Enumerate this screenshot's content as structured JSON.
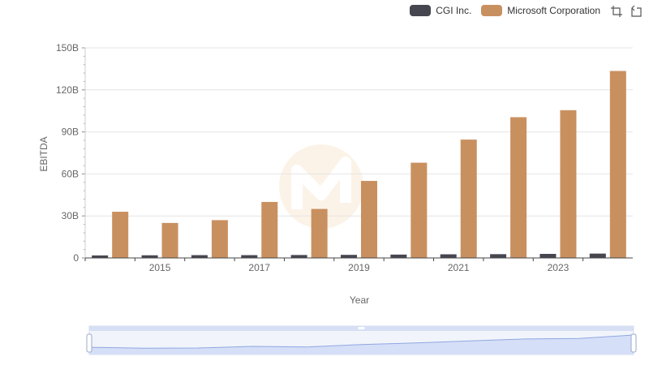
{
  "chart_data": {
    "type": "bar",
    "xlabel": "Year",
    "ylabel": "EBITDA",
    "ylim": [
      0,
      150000000000
    ],
    "y_ticks": [
      0,
      30000000000,
      60000000000,
      90000000000,
      120000000000,
      150000000000
    ],
    "y_tick_labels": [
      "0",
      "30B",
      "60B",
      "90B",
      "120B",
      "150B"
    ],
    "x": [
      2014,
      2015,
      2016,
      2017,
      2018,
      2019,
      2020,
      2021,
      2022,
      2023,
      2024
    ],
    "x_tick_labels": [
      {
        "year": 2015,
        "label": "2015"
      },
      {
        "year": 2017,
        "label": "2017"
      },
      {
        "year": 2019,
        "label": "2019"
      },
      {
        "year": 2021,
        "label": "2021"
      },
      {
        "year": 2023,
        "label": "2023"
      }
    ],
    "series": [
      {
        "name": "CGI Inc.",
        "color": "#464650",
        "values": [
          1800000000,
          1900000000,
          2000000000,
          2000000000,
          2100000000,
          2200000000,
          2400000000,
          2600000000,
          2700000000,
          2900000000,
          3100000000
        ]
      },
      {
        "name": "Microsoft Corporation",
        "color": "#c9905f",
        "values": [
          33000000000,
          25000000000,
          27000000000,
          40000000000,
          35000000000,
          55000000000,
          68000000000,
          84500000000,
          100500000000,
          105500000000,
          133500000000
        ]
      }
    ],
    "grid": true,
    "legend_position": "top-right",
    "data_zoom": {
      "start": 0,
      "end": 100
    }
  },
  "icons": {
    "zoom": "zoom-icon",
    "restore": "restore-icon"
  }
}
